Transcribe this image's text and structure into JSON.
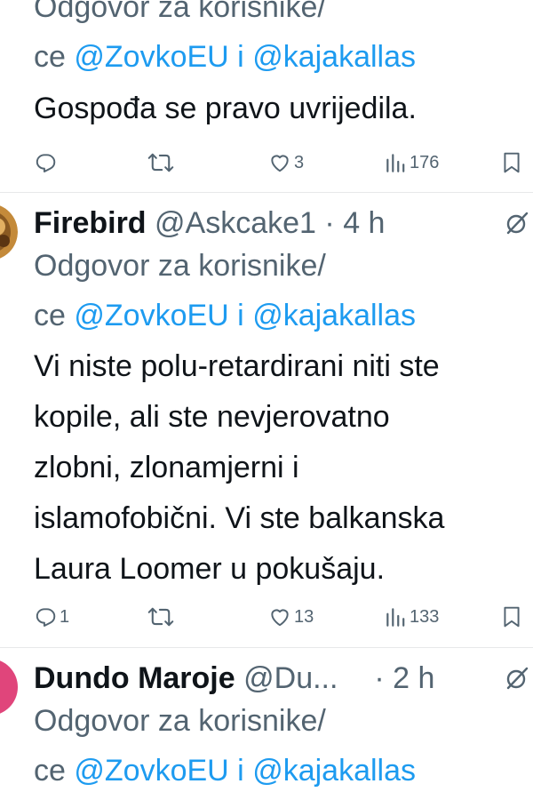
{
  "tweets": [
    {
      "reply_to_line1": "Odgovor za korisnike/",
      "reply_to_line2_prefix": "ce",
      "mention1": "@ZovkoEU",
      "mention_joiner": "i",
      "mention2": "@kajakallas",
      "body_lines": [
        "Gospođa se pravo uvrijedila."
      ],
      "stats": {
        "replies": "",
        "retweets": "",
        "likes": "3",
        "views": "176"
      },
      "icons": [
        "reply-icon",
        "retweet-icon",
        "like-icon",
        "views-icon",
        "bookmark-icon"
      ]
    },
    {
      "display_name": "Firebird",
      "handle": "@Askcake1",
      "separator": "·",
      "time": "4 h",
      "reply_to_line1": "Odgovor za korisnike/",
      "reply_to_line2_prefix": "ce",
      "mention1": "@ZovkoEU",
      "mention_joiner": "i",
      "mention2": "@kajakallas",
      "body_lines": [
        "Vi niste polu-retardirani niti ste",
        "kopile, ali ste nevjerovatno",
        "zlobni, zlonamjerni i",
        "islamofobični. Vi ste balkanska",
        "Laura Loomer u pokušaju."
      ],
      "stats": {
        "replies": "1",
        "retweets": "",
        "likes": "13",
        "views": "133"
      },
      "icons": [
        "grok-icon",
        "reply-icon",
        "retweet-icon",
        "like-icon",
        "views-icon",
        "bookmark-icon"
      ]
    },
    {
      "display_name": "Dundo Maroje",
      "handle": "@Du...",
      "separator": "·",
      "time": "2 h",
      "reply_to_line1": "Odgovor za korisnike/",
      "reply_to_line2_prefix": "ce",
      "mention1": "@ZovkoEU",
      "mention_joiner": "i",
      "mention2": "@kajakallas",
      "icons": [
        "grok-icon"
      ]
    }
  ],
  "colors": {
    "text": "#0f1419",
    "muted": "#536471",
    "link": "#1d9bf0",
    "divider": "#e7e9ea",
    "avatar_pink": "#e0457b"
  }
}
